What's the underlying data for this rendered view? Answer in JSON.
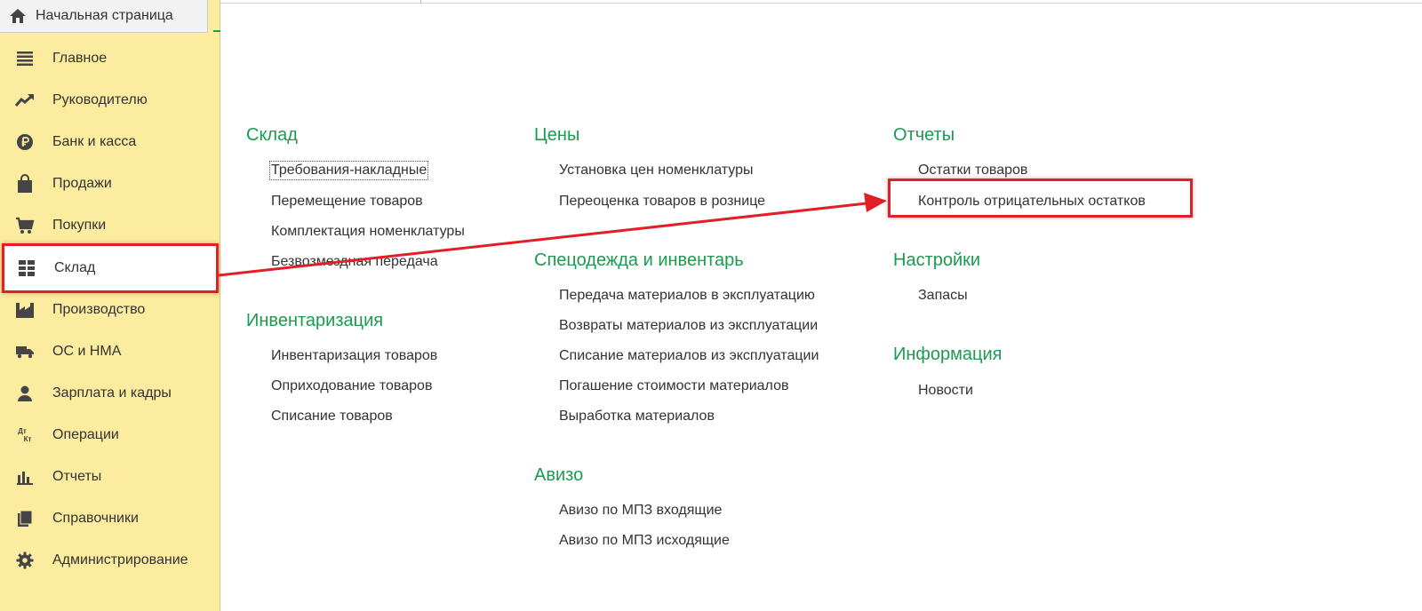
{
  "home_tab": {
    "label": "Начальная страница",
    "icon": "home-icon"
  },
  "sidebar": {
    "items": [
      {
        "label": "Главное",
        "icon": "menu-lines-icon"
      },
      {
        "label": "Руководителю",
        "icon": "trend-up-icon"
      },
      {
        "label": "Банк и касса",
        "icon": "ruble-coin-icon"
      },
      {
        "label": "Продажи",
        "icon": "shopping-bag-icon"
      },
      {
        "label": "Покупки",
        "icon": "cart-icon"
      },
      {
        "label": "Склад",
        "icon": "warehouse-grid-icon",
        "active": true
      },
      {
        "label": "Производство",
        "icon": "factory-icon"
      },
      {
        "label": "ОС и НМА",
        "icon": "truck-icon"
      },
      {
        "label": "Зарплата и кадры",
        "icon": "person-icon"
      },
      {
        "label": "Операции",
        "icon": "debit-credit-icon",
        "icon_text_top": "Дт",
        "icon_text_bottom": "Кт"
      },
      {
        "label": "Отчеты",
        "icon": "bar-chart-icon"
      },
      {
        "label": "Справочники",
        "icon": "books-icon"
      },
      {
        "label": "Администрирование",
        "icon": "gear-icon"
      }
    ]
  },
  "sections": {
    "sklad": {
      "title": "Склад",
      "links": [
        "Требования-накладные",
        "Перемещение товаров",
        "Комплектация номенклатуры",
        "Безвозмездная передача"
      ]
    },
    "inventarizaciya": {
      "title": "Инвентаризация",
      "links": [
        "Инвентаризация товаров",
        "Оприходование товаров",
        "Списание товаров"
      ]
    },
    "ceny": {
      "title": "Цены",
      "links": [
        "Установка цен номенклатуры",
        "Переоценка товаров в рознице"
      ]
    },
    "specodezhda": {
      "title": "Спецодежда и инвентарь",
      "links": [
        "Передача материалов в эксплуатацию",
        "Возвраты материалов из эксплуатации",
        "Списание материалов из эксплуатации",
        "Погашение стоимости материалов",
        "Выработка материалов"
      ]
    },
    "avizo": {
      "title": "Авизо",
      "links": [
        "Авизо по МПЗ входящие",
        "Авизо по МПЗ исходящие"
      ]
    },
    "otchety": {
      "title": "Отчеты",
      "links": [
        "Остатки товаров",
        "Контроль отрицательных остатков"
      ]
    },
    "nastroyki": {
      "title": "Настройки",
      "links": [
        "Запасы"
      ]
    },
    "informaciya": {
      "title": "Информация",
      "links": [
        "Новости"
      ]
    }
  },
  "colors": {
    "sidebar_bg": "#fbec9f",
    "section_title": "#1a9b4f",
    "annotation_red": "#e01f26"
  }
}
